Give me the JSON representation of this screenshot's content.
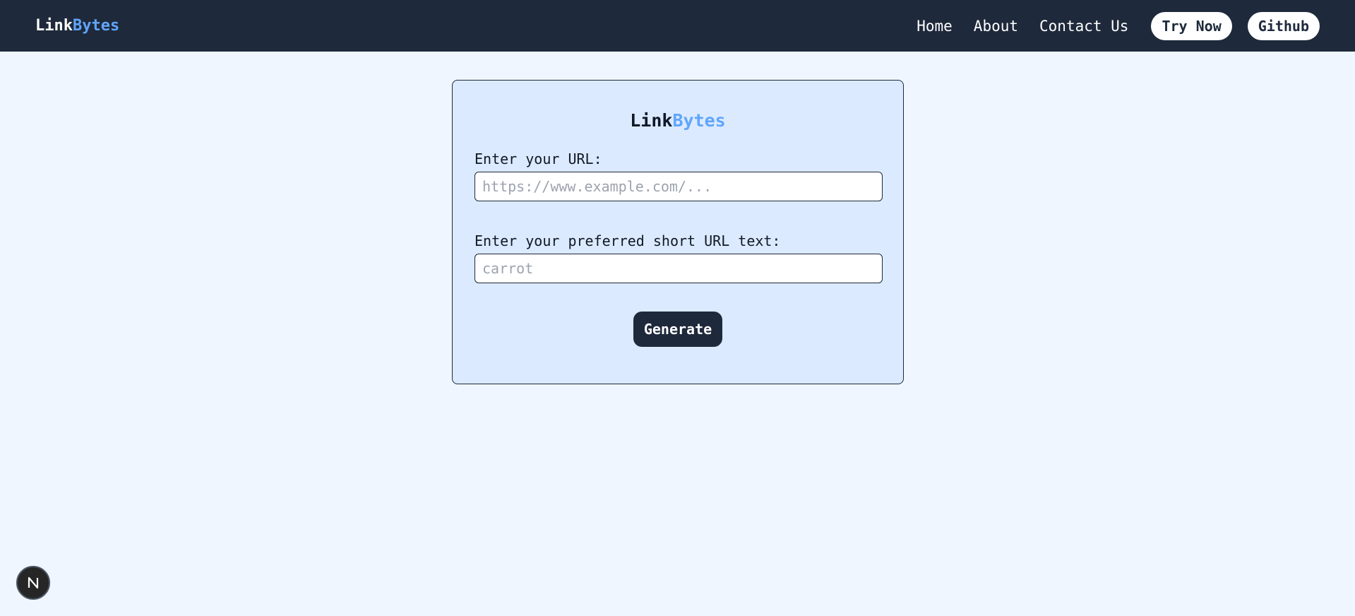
{
  "navbar": {
    "logo_part1": "Link",
    "logo_part2": "Bytes",
    "links": [
      "Home",
      "About",
      "Contact Us"
    ],
    "try_now_label": "Try Now",
    "github_label": "Github"
  },
  "card": {
    "title_part1": "Link",
    "title_part2": "Bytes",
    "url_label": "Enter your URL:",
    "url_placeholder": "https://www.example.com/...",
    "url_value": "",
    "short_label": "Enter your preferred short URL text:",
    "short_placeholder": "carrot",
    "short_value": "",
    "generate_label": "Generate"
  },
  "dev_badge": {
    "icon": "nextjs-logo-icon"
  },
  "colors": {
    "navbar_bg": "#1e293b",
    "page_bg": "#eff6ff",
    "card_bg": "#dbeafe",
    "accent": "#60a5fa"
  }
}
